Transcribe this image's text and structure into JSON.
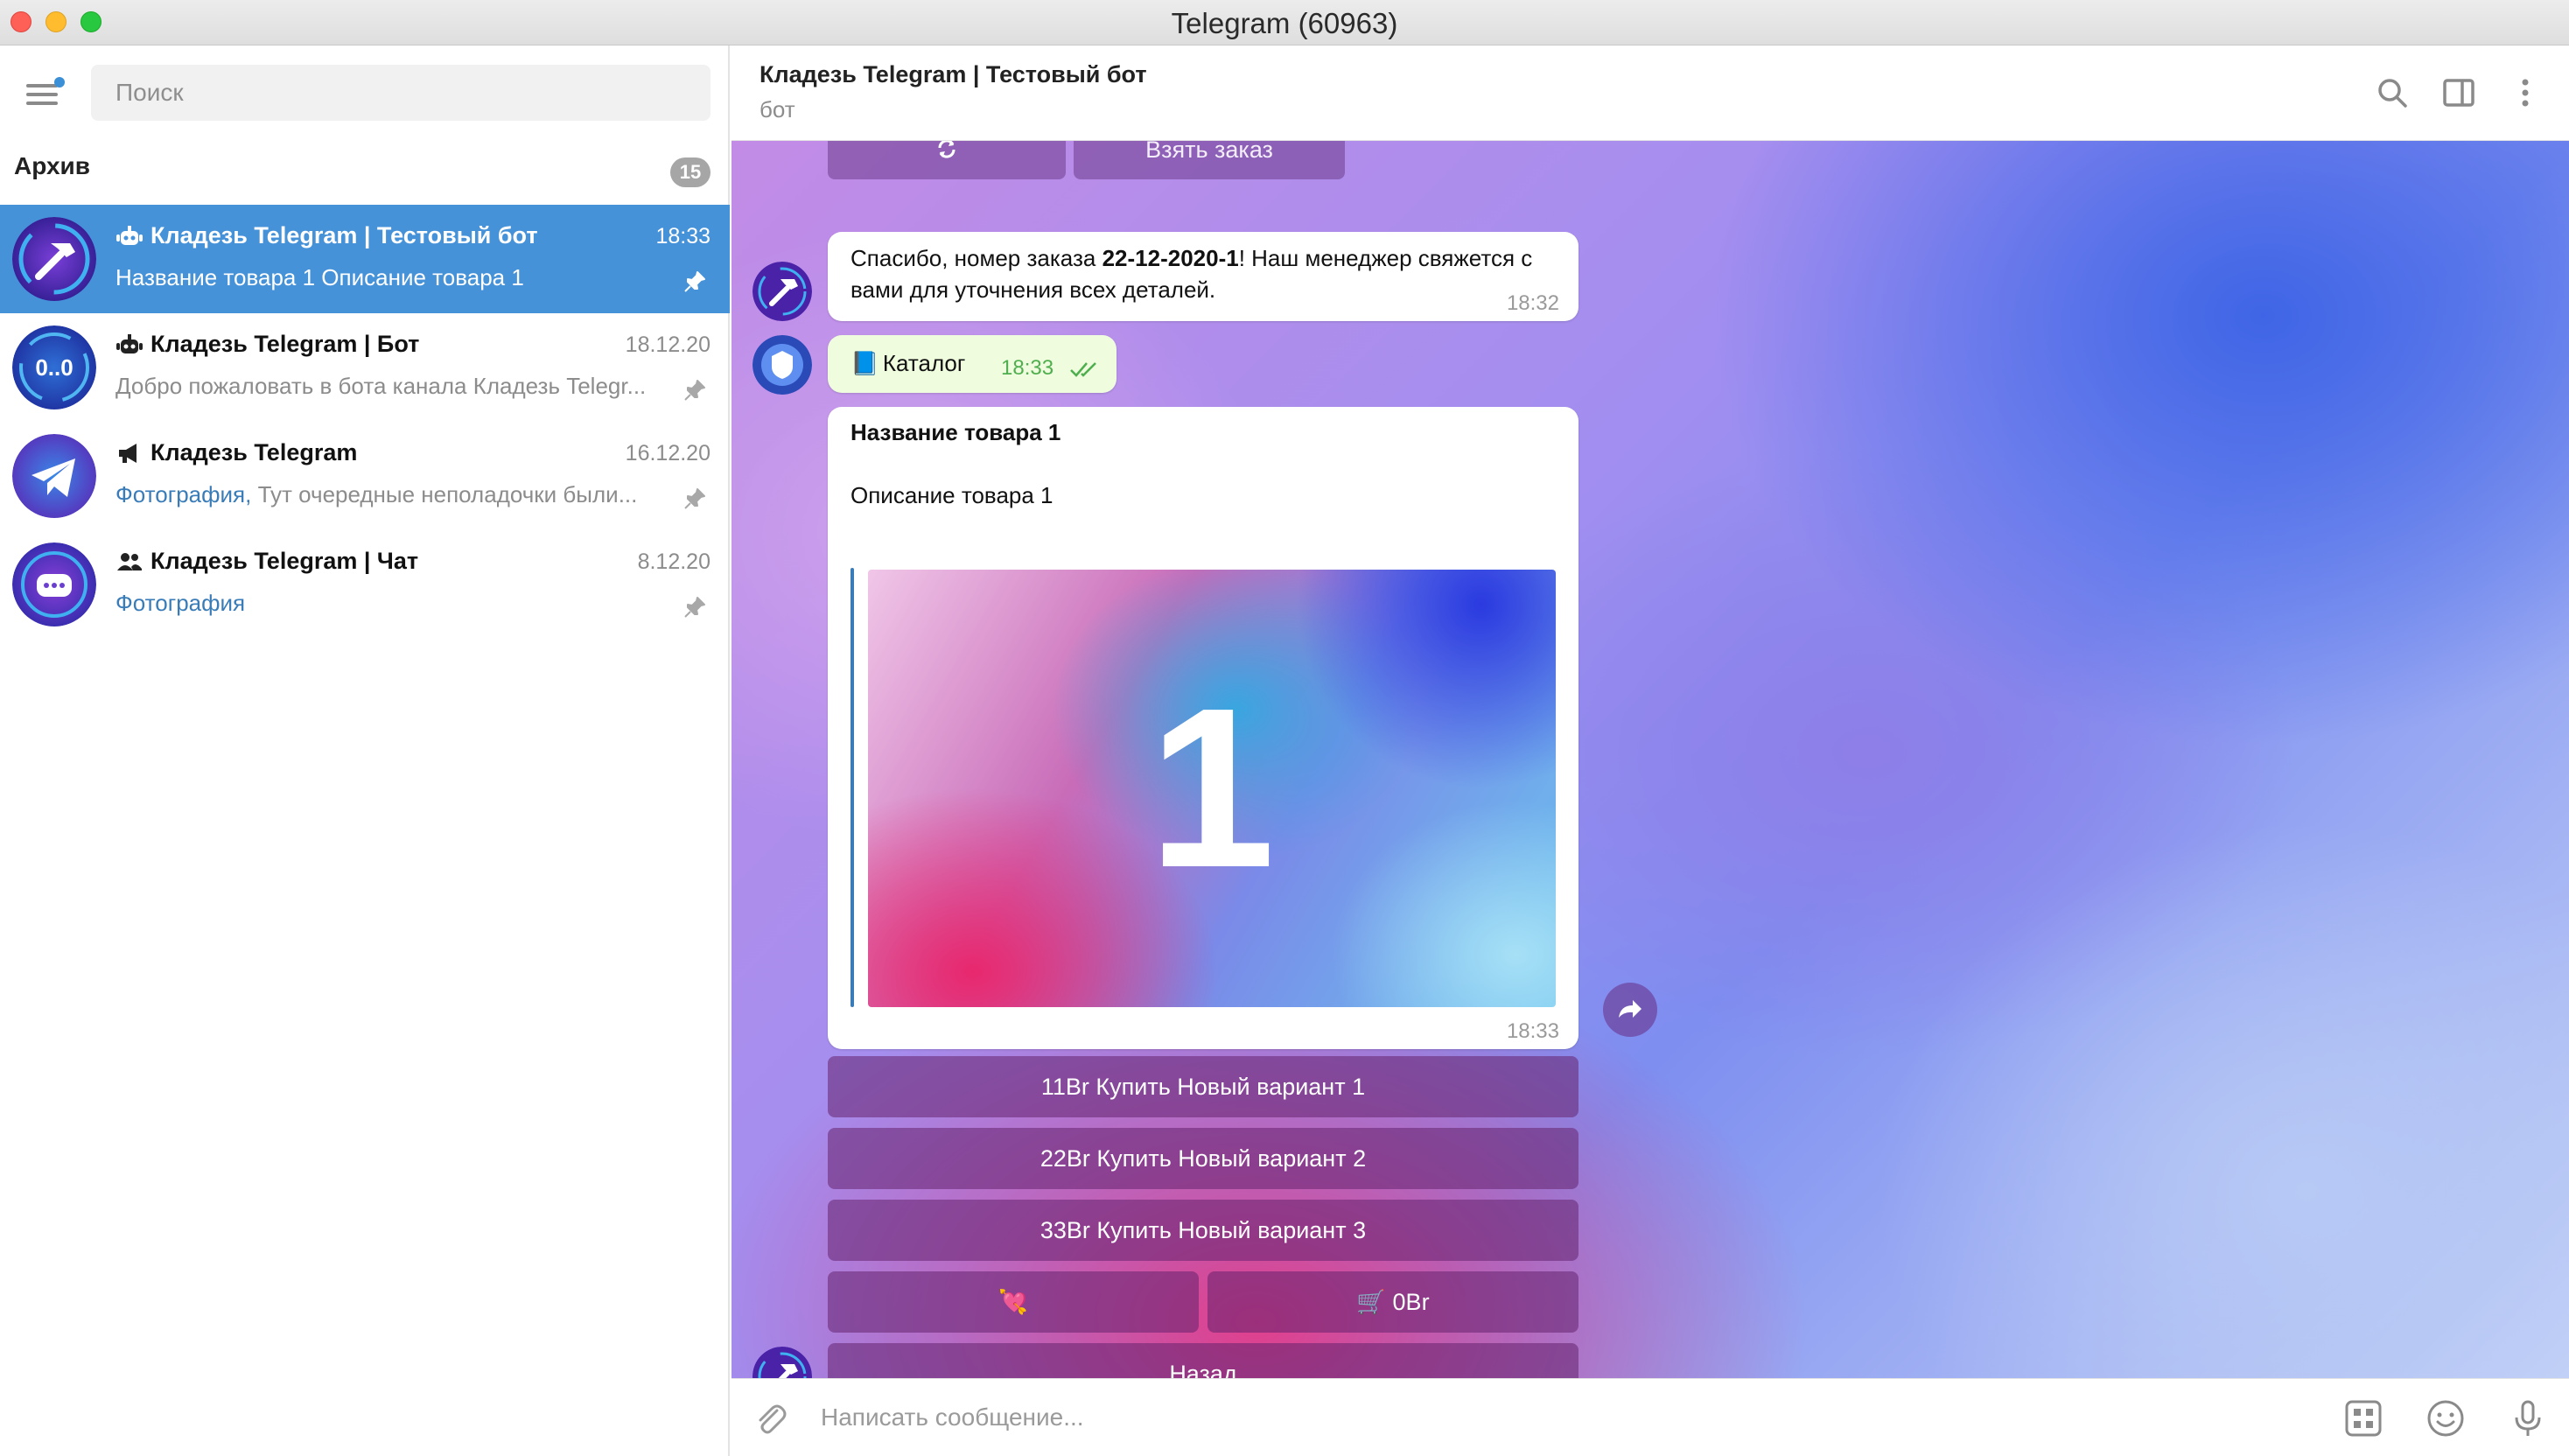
{
  "window": {
    "title": "Telegram (60963)"
  },
  "sidebar": {
    "search_placeholder": "Поиск",
    "archive": {
      "label": "Архив",
      "count": "15"
    },
    "chats": [
      {
        "title": "Кладезь Telegram | Тестовый бот",
        "time": "18:33",
        "preview": "Название товара 1  Описание товара 1",
        "preview_accent": "",
        "type_icon": "bot-icon",
        "pinned": true,
        "active": true
      },
      {
        "title": "Кладезь Telegram | Бот",
        "time": "18.12.20",
        "preview": "Добро пожаловать в бота канала Кладезь Telegr...",
        "preview_accent": "",
        "type_icon": "bot-icon",
        "pinned": true,
        "active": false,
        "avatar_text": "0..0"
      },
      {
        "title": "Кладезь Telegram",
        "time": "16.12.20",
        "preview": "Тут очередные неполадочки были...",
        "preview_accent": "Фотография, ",
        "type_icon": "megaphone-icon",
        "pinned": true,
        "active": false
      },
      {
        "title": "Кладезь Telegram | Чат",
        "time": "8.12.20",
        "preview": "",
        "preview_accent": "Фотография",
        "type_icon": "group-icon",
        "pinned": true,
        "active": false
      }
    ]
  },
  "chat": {
    "header": {
      "title": "Кладезь Telegram | Тестовый бот",
      "status": "бот"
    },
    "top_keyboard": {
      "refresh_label": "",
      "take_order_label": "Взять заказ"
    },
    "messages": {
      "order_msg": {
        "text_prefix": "Спасибо, номер заказа ",
        "order_number": "22-12-2020-1",
        "text_suffix": "! Наш менеджер свяжется с вами для уточнения всех деталей.",
        "time": "18:32"
      },
      "catalog_msg": {
        "emoji": "📘",
        "text": "Каталог",
        "time": "18:33"
      },
      "product_msg": {
        "title": "Название товара 1",
        "description": "Описание товара 1",
        "image_number": "1",
        "time": "18:33"
      }
    },
    "keyboard": {
      "buy1": "11Br Купить Новый вариант 1",
      "buy2": "22Br Купить Новый вариант 2",
      "buy3": "33Br Купить Новый вариант 3",
      "favorite": "💘",
      "cart": "🛒 0Br",
      "back": "Назад"
    },
    "composer": {
      "placeholder": "Написать сообщение..."
    }
  },
  "colors": {
    "accent": "#4592d9",
    "link": "#3a7cb8",
    "outgoing_bubble": "#effdde",
    "check": "#4fae4e"
  }
}
